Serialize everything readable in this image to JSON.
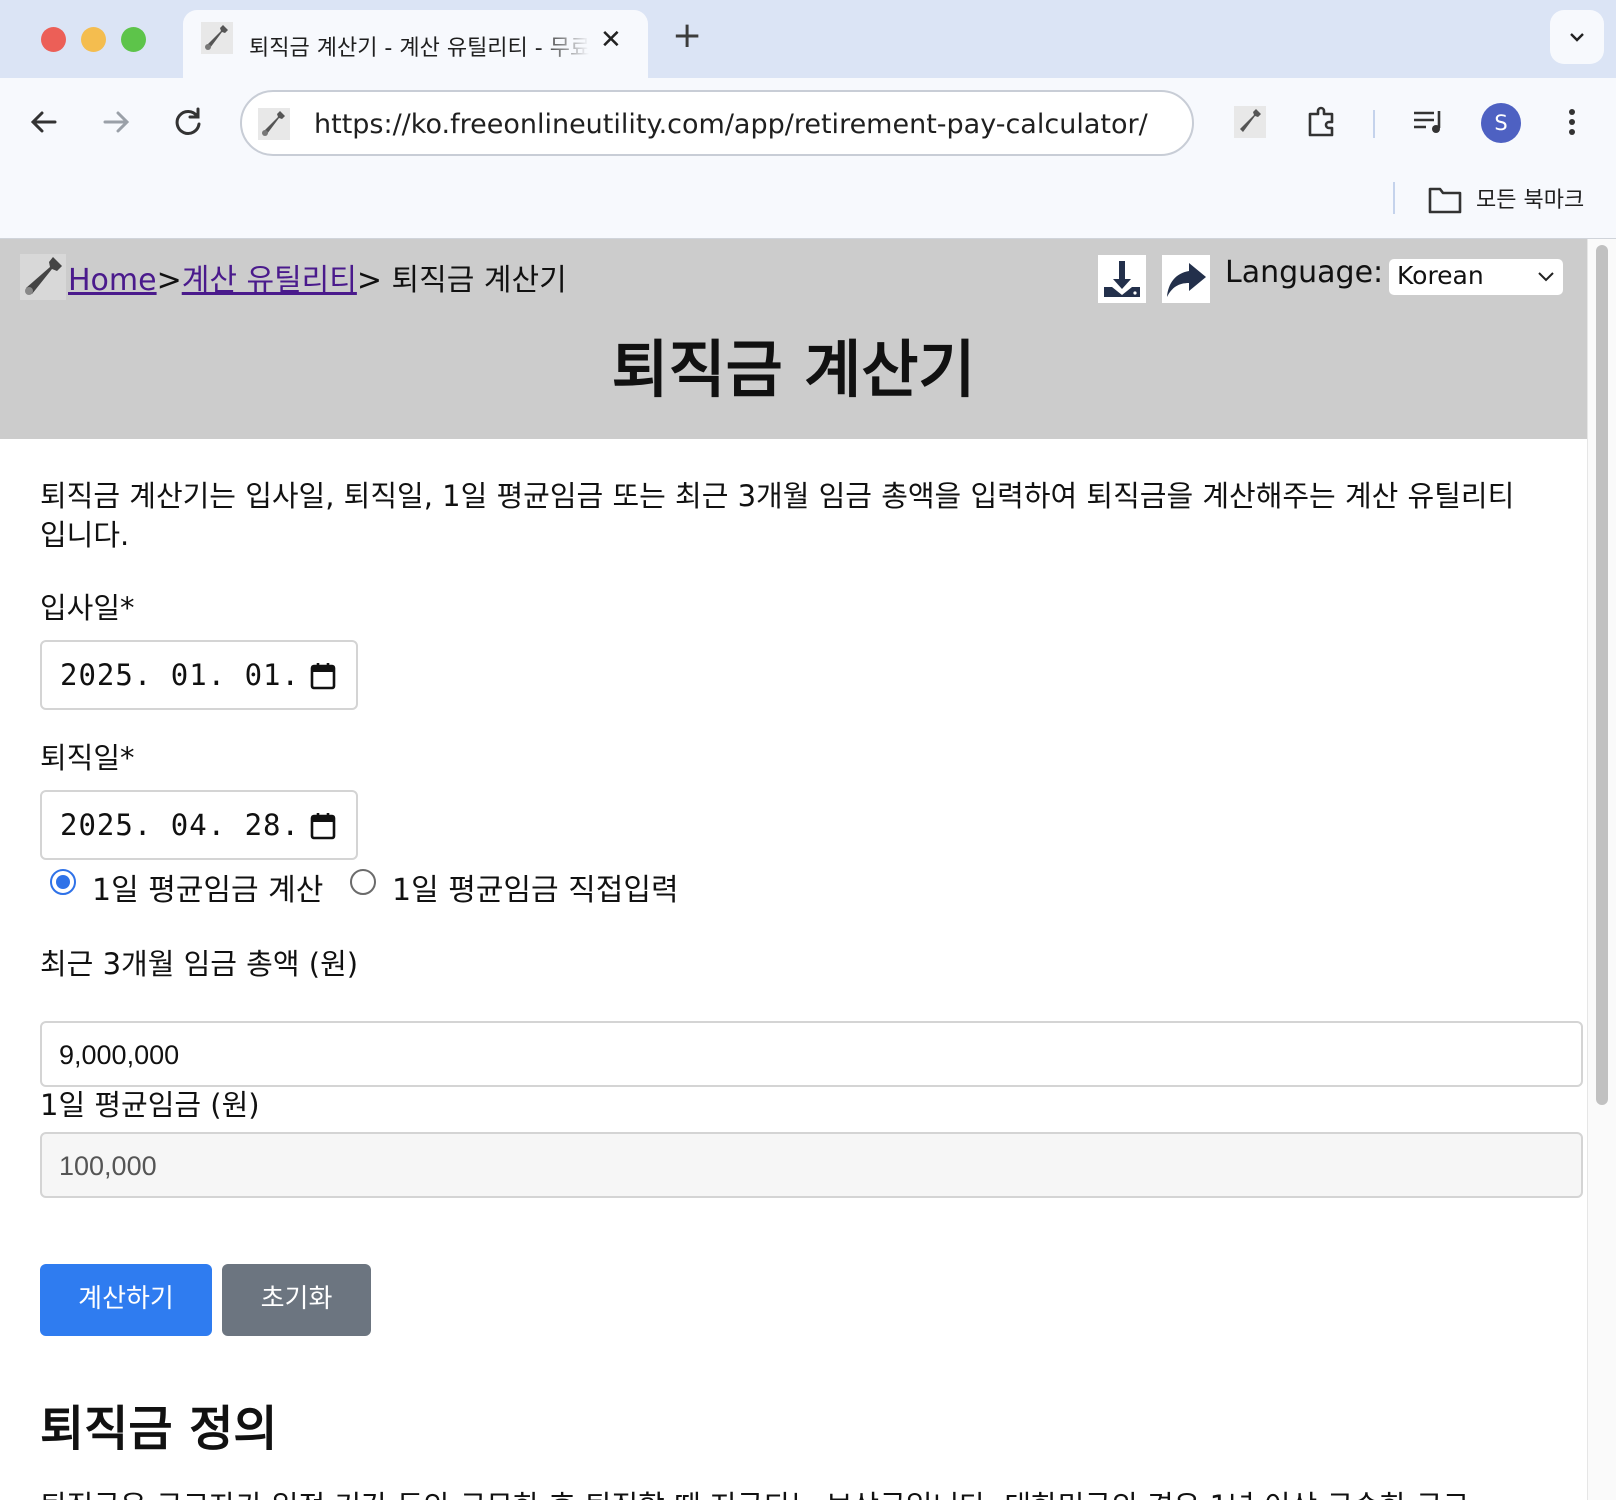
{
  "browser": {
    "tab_title": "퇴직금 계산기 - 계산 유틸리티 - 무료 온라인 유틸리티",
    "url": "https://ko.freeonlineutility.com/app/retirement-pay-calculator/",
    "avatar_initial": "S",
    "bookmarks_label": "모든 북마크"
  },
  "header": {
    "breadcrumb": {
      "home": "Home",
      "sep1": ">",
      "category": "계산 유틸리티",
      "current": "> 퇴직금 계산기"
    },
    "language_label": "Language:",
    "language_value": "Korean",
    "title": "퇴직금 계산기"
  },
  "main": {
    "description": "퇴직금 계산기는 입사일, 퇴직일, 1일 평균임금 또는 최근 3개월 임금 총액을 입력하여 퇴직금을 계산해주는 계산 유틸리티입니다.",
    "start_date": {
      "label": "입사일*",
      "value": "2025. 01. 01."
    },
    "end_date": {
      "label": "퇴직일*",
      "value": "2025. 04. 28."
    },
    "mode_options": [
      {
        "label": "1일 평균임금 계산",
        "selected": true
      },
      {
        "label": "1일 평균임금 직접입력",
        "selected": false
      }
    ],
    "wage_total": {
      "label": "최근 3개월 임금 총액 (원)",
      "value": "9,000,000"
    },
    "daily_wage": {
      "label": "1일 평균임금 (원)",
      "value": "100,000"
    },
    "calc_button": "계산하기",
    "reset_button": "초기화",
    "section_title": "퇴직금 정의",
    "section_text_partial": "퇴직금은 근로자가 일정 기간 동안 근무한 후 퇴직할 때 지급되는 보상금입니다. 대한민국의 경우 1년 이상 근속한 근로"
  },
  "colors": {
    "header_bg": "#cccccc",
    "primary": "#2f7cf0",
    "secondary": "#6c7580",
    "link": "#4a1a8c",
    "radio_selected": "#2f72e8"
  }
}
